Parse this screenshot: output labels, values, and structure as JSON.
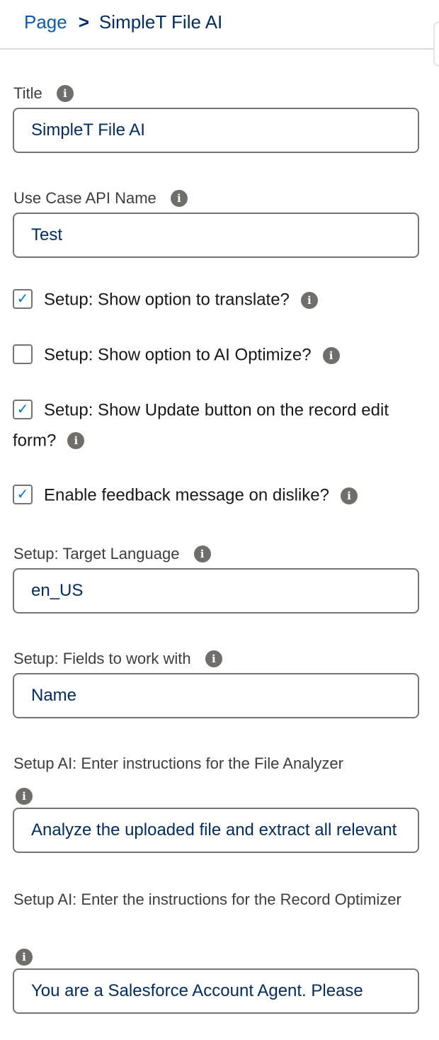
{
  "breadcrumb": {
    "parent": "Page",
    "separator": ">",
    "current": "SimpleT File AI"
  },
  "fields": {
    "title": {
      "label": "Title",
      "value": "SimpleT File AI"
    },
    "use_case": {
      "label": "Use Case API Name",
      "value": "Test"
    },
    "target_language": {
      "label": "Setup: Target Language",
      "value": "en_US"
    },
    "fields_to_work": {
      "label": "Setup: Fields to work with",
      "value": "Name"
    },
    "file_analyzer": {
      "label": "Setup AI: Enter instructions for the File Analyzer",
      "value": "Analyze the uploaded file and extract all relevant information"
    },
    "record_optimizer": {
      "label": "Setup AI: Enter the instructions for the Record Optimizer",
      "value": "You are a Salesforce Account Agent. Please"
    }
  },
  "checkboxes": [
    {
      "label": "Setup: Show option to translate?",
      "checked": true,
      "mark": "✓"
    },
    {
      "label": "Setup: Show option to AI Optimize?",
      "checked": false,
      "mark": ""
    },
    {
      "label": "Setup: Show Update button on the record edit form?",
      "checked": true,
      "mark": "✓"
    },
    {
      "label": "Enable feedback message on dislike?",
      "checked": true,
      "mark": "✓"
    }
  ],
  "icons": {
    "info": "i"
  },
  "colors": {
    "link": "#0b5cab",
    "text_dark": "#032d60",
    "checkmark": "#0176d3",
    "info_icon_bg": "#706e6b",
    "input_border": "#747474"
  }
}
